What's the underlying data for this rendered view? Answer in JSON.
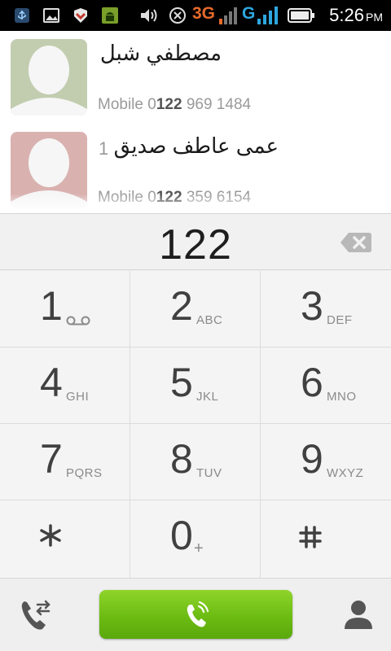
{
  "status_bar": {
    "time": "5:26",
    "ampm": "PM",
    "network_1": "3G",
    "network_2": "G",
    "icons": [
      "usb-icon",
      "image-notification-icon",
      "app-notification-icon",
      "android-debug-icon",
      "volume-icon",
      "data-sync-icon",
      "signal-icon",
      "battery-icon"
    ]
  },
  "contacts": [
    {
      "name": "مصطفي شبل",
      "index": "",
      "phone_label": "Mobile",
      "phone_prefix": "0",
      "phone_match": "122",
      "phone_rest": " 969 1484",
      "avatar_color": "#c2cdb0"
    },
    {
      "name": "عمى عاطف صديق",
      "index": "1",
      "phone_label": "Mobile",
      "phone_prefix": "0",
      "phone_match": "122",
      "phone_rest": " 359 6154",
      "avatar_color": "#d9b2b0"
    }
  ],
  "dialer": {
    "number": "122"
  },
  "keypad": [
    {
      "digit": "1",
      "letters": ""
    },
    {
      "digit": "2",
      "letters": "ABC"
    },
    {
      "digit": "3",
      "letters": "DEF"
    },
    {
      "digit": "4",
      "letters": "GHI"
    },
    {
      "digit": "5",
      "letters": "JKL"
    },
    {
      "digit": "6",
      "letters": "MNO"
    },
    {
      "digit": "7",
      "letters": "PQRS"
    },
    {
      "digit": "8",
      "letters": "TUV"
    },
    {
      "digit": "9",
      "letters": "WXYZ"
    },
    {
      "digit": "0",
      "letters": "+"
    }
  ],
  "colors": {
    "call_button": "#6cbc13",
    "network_3g": "#e56a2b",
    "network_g": "#2ea7e0"
  }
}
